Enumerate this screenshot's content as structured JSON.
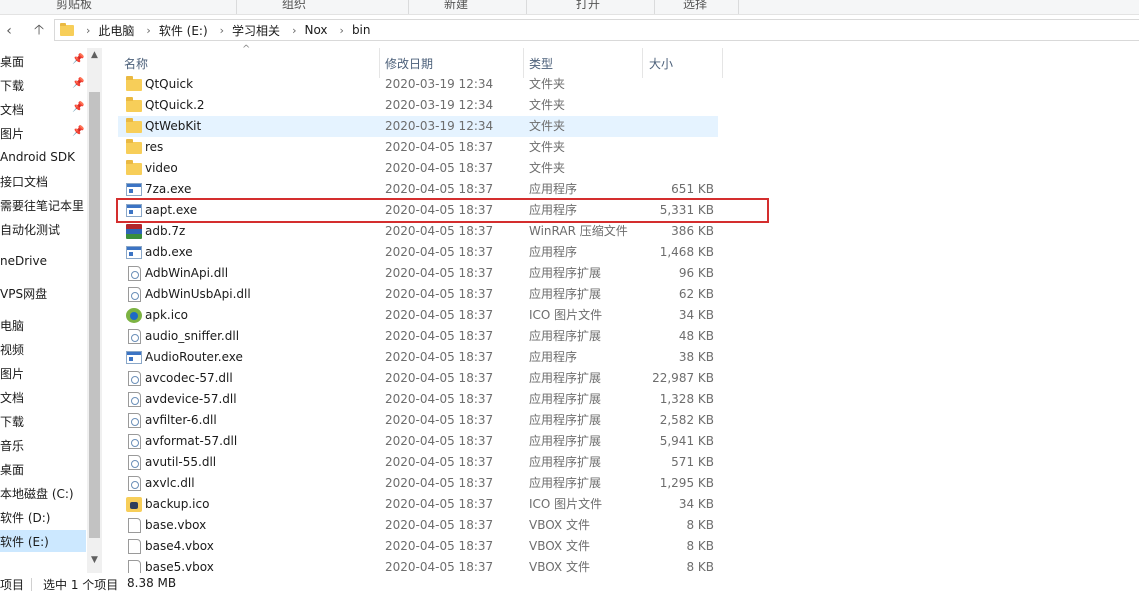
{
  "ribbon": {
    "groups": [
      "剪贴板",
      "组织",
      "新建",
      "打开",
      "选择"
    ]
  },
  "nav": {
    "back_icon": "chevron-left-icon",
    "up_icon": "arrow-up-icon"
  },
  "address": {
    "crumbs": [
      "此电脑",
      "软件 (E:)",
      "学习相关",
      "Nox",
      "bin"
    ]
  },
  "sidebar": {
    "items": [
      {
        "label": "桌面",
        "pinned": true
      },
      {
        "label": "下载",
        "pinned": true
      },
      {
        "label": "文档",
        "pinned": true
      },
      {
        "label": "图片",
        "pinned": true
      },
      {
        "label": "Android SDK",
        "pinned": false
      },
      {
        "label": "接口文档",
        "pinned": false
      },
      {
        "label": "需要往笔记本里",
        "pinned": false
      },
      {
        "label": "自动化测试",
        "pinned": false
      },
      {
        "label": "neDrive",
        "pinned": false
      },
      {
        "label": "VPS网盘",
        "pinned": false
      },
      {
        "label": "电脑",
        "pinned": false
      },
      {
        "label": "视频",
        "pinned": false
      },
      {
        "label": "图片",
        "pinned": false
      },
      {
        "label": "文档",
        "pinned": false
      },
      {
        "label": "下载",
        "pinned": false
      },
      {
        "label": "音乐",
        "pinned": false
      },
      {
        "label": "桌面",
        "pinned": false
      },
      {
        "label": "本地磁盘 (C:)",
        "pinned": false
      },
      {
        "label": "软件 (D:)",
        "pinned": false
      },
      {
        "label": "软件 (E:)",
        "pinned": false,
        "selected": true
      }
    ]
  },
  "columns": {
    "name": "名称",
    "date": "修改日期",
    "type": "类型",
    "size": "大小"
  },
  "files": [
    {
      "name": "QtQuick",
      "date": "2020-03-19 12:34",
      "type": "文件夹",
      "size": "",
      "icon": "folder"
    },
    {
      "name": "QtQuick.2",
      "date": "2020-03-19 12:34",
      "type": "文件夹",
      "size": "",
      "icon": "folder"
    },
    {
      "name": "QtWebKit",
      "date": "2020-03-19 12:34",
      "type": "文件夹",
      "size": "",
      "icon": "folder",
      "hover": true
    },
    {
      "name": "res",
      "date": "2020-04-05 18:37",
      "type": "文件夹",
      "size": "",
      "icon": "folder"
    },
    {
      "name": "video",
      "date": "2020-04-05 18:37",
      "type": "文件夹",
      "size": "",
      "icon": "folder"
    },
    {
      "name": "7za.exe",
      "date": "2020-04-05 18:37",
      "type": "应用程序",
      "size": "651 KB",
      "icon": "exe"
    },
    {
      "name": "aapt.exe",
      "date": "2020-04-05 18:37",
      "type": "应用程序",
      "size": "5,331 KB",
      "icon": "exe",
      "highlighted": true
    },
    {
      "name": "adb.7z",
      "date": "2020-04-05 18:37",
      "type": "WinRAR 压缩文件",
      "size": "386 KB",
      "icon": "rar"
    },
    {
      "name": "adb.exe",
      "date": "2020-04-05 18:37",
      "type": "应用程序",
      "size": "1,468 KB",
      "icon": "exe"
    },
    {
      "name": "AdbWinApi.dll",
      "date": "2020-04-05 18:37",
      "type": "应用程序扩展",
      "size": "96 KB",
      "icon": "dll"
    },
    {
      "name": "AdbWinUsbApi.dll",
      "date": "2020-04-05 18:37",
      "type": "应用程序扩展",
      "size": "62 KB",
      "icon": "dll"
    },
    {
      "name": "apk.ico",
      "date": "2020-04-05 18:37",
      "type": "ICO 图片文件",
      "size": "34 KB",
      "icon": "apk"
    },
    {
      "name": "audio_sniffer.dll",
      "date": "2020-04-05 18:37",
      "type": "应用程序扩展",
      "size": "48 KB",
      "icon": "dll"
    },
    {
      "name": "AudioRouter.exe",
      "date": "2020-04-05 18:37",
      "type": "应用程序",
      "size": "38 KB",
      "icon": "exe"
    },
    {
      "name": "avcodec-57.dll",
      "date": "2020-04-05 18:37",
      "type": "应用程序扩展",
      "size": "22,987 KB",
      "icon": "dll"
    },
    {
      "name": "avdevice-57.dll",
      "date": "2020-04-05 18:37",
      "type": "应用程序扩展",
      "size": "1,328 KB",
      "icon": "dll"
    },
    {
      "name": "avfilter-6.dll",
      "date": "2020-04-05 18:37",
      "type": "应用程序扩展",
      "size": "2,582 KB",
      "icon": "dll"
    },
    {
      "name": "avformat-57.dll",
      "date": "2020-04-05 18:37",
      "type": "应用程序扩展",
      "size": "5,941 KB",
      "icon": "dll"
    },
    {
      "name": "avutil-55.dll",
      "date": "2020-04-05 18:37",
      "type": "应用程序扩展",
      "size": "571 KB",
      "icon": "dll"
    },
    {
      "name": "axvlc.dll",
      "date": "2020-04-05 18:37",
      "type": "应用程序扩展",
      "size": "1,295 KB",
      "icon": "dll"
    },
    {
      "name": "backup.ico",
      "date": "2020-04-05 18:37",
      "type": "ICO 图片文件",
      "size": "34 KB",
      "icon": "backup"
    },
    {
      "name": "base.vbox",
      "date": "2020-04-05 18:37",
      "type": "VBOX 文件",
      "size": "8 KB",
      "icon": "file"
    },
    {
      "name": "base4.vbox",
      "date": "2020-04-05 18:37",
      "type": "VBOX 文件",
      "size": "8 KB",
      "icon": "file"
    },
    {
      "name": "base5.vbox",
      "date": "2020-04-05 18:37",
      "type": "VBOX 文件",
      "size": "8 KB",
      "icon": "file"
    }
  ],
  "status": {
    "items_label": "项目",
    "selection": "选中 1 个项目",
    "size": "8.38 MB"
  },
  "colors": {
    "highlight_border": "#d42e2e",
    "hover_row": "#e5f3ff",
    "selected_nav": "#cce8ff"
  }
}
